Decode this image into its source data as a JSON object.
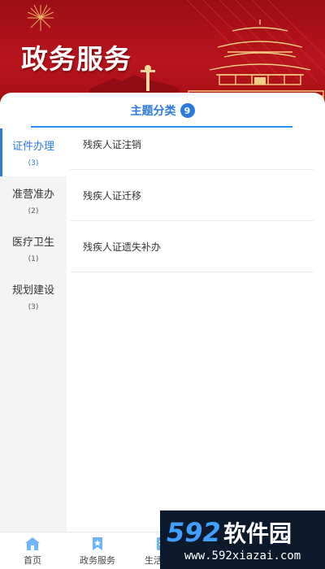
{
  "banner": {
    "title": "政务服务"
  },
  "header": {
    "title": "主题分类",
    "count": "9"
  },
  "sidebar": {
    "items": [
      {
        "label": "证件办理",
        "count": "(3)",
        "active": true
      },
      {
        "label": "准营准办",
        "count": "(2)",
        "active": false
      },
      {
        "label": "医疗卫生",
        "count": "(1)",
        "active": false
      },
      {
        "label": "规划建设",
        "count": "(3)",
        "active": false
      }
    ]
  },
  "list": {
    "items": [
      {
        "label": "残疾人证注销"
      },
      {
        "label": "残疾人证迁移"
      },
      {
        "label": "残疾人证遗失补办"
      }
    ]
  },
  "bottom_nav": {
    "items": [
      {
        "label": "首页",
        "icon": "home-icon"
      },
      {
        "label": "政务服务",
        "icon": "star-bookmark-icon"
      },
      {
        "label": "生活服务",
        "icon": "life-service-icon"
      },
      {
        "label": "",
        "icon": ""
      },
      {
        "label": "",
        "icon": ""
      }
    ]
  },
  "watermark": {
    "logo_text": "592软件园",
    "url": "www.592xiazai.com"
  },
  "colors": {
    "banner_red": "#b8141c",
    "accent_blue": "#2b7ae0",
    "sidebar_bg": "#f4f4f4",
    "nav_blue": "#3d9bf2"
  }
}
